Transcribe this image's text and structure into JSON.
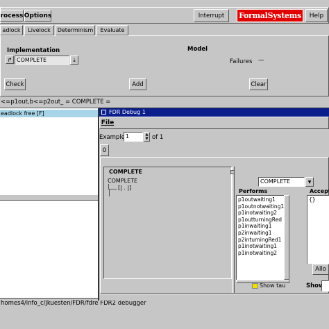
{
  "main": {
    "menu": [
      "rocess",
      "Options"
    ],
    "interrupt_label": "Interrupt",
    "logo_text": "FormalSystems",
    "help_label": "Help",
    "tabs": [
      "adlock",
      "Livelock",
      "Determinism",
      "Evaluate"
    ],
    "implementation_label": "Implementation",
    "model_label": "Model",
    "impl_value": "COMPLETE",
    "failures_label": "Failures",
    "failures_value": "—",
    "buttons": {
      "check": "Check",
      "add": "Add",
      "clear": "Clear"
    },
    "assertion_line": "<=p1out,b<=p2out_ =  COMPLETE =",
    "selected_line": "eadlock free [F]",
    "status_text": "homes4/info_c/jkuesten/FDR/fdre FDR2 debugger"
  },
  "debug": {
    "title": "FDR Debug 1",
    "menu_file": "File",
    "example_label": "Example",
    "example_value": "1",
    "of_label": "of 1",
    "tab_zero": "0",
    "tree_header": "COMPLETE",
    "tree_node": "COMPLETE",
    "tree_child": "[| . |]",
    "selector_value": "COMPLETE",
    "performs_label": "Performs",
    "performs": [
      "p1outwaiting1",
      "p1outnotwaiting1",
      "p1inotwaiting2",
      "p1outturningRed",
      "p1inwaiting1",
      "p2inwaiting1",
      "p2inturningRed1",
      "p1inotwaiting1",
      "p1inotwaiting2"
    ],
    "accept_label": "Accept",
    "accept_items": [
      "{}"
    ],
    "accept_button": "Allo",
    "show_tau_label": "Show tau",
    "show_label": "Show"
  },
  "colors": {
    "title_bar": "#0a1e8c",
    "logo_bg": "#e00000",
    "highlight": "#a8d4e8",
    "show_tau_square": "#f0e000"
  }
}
